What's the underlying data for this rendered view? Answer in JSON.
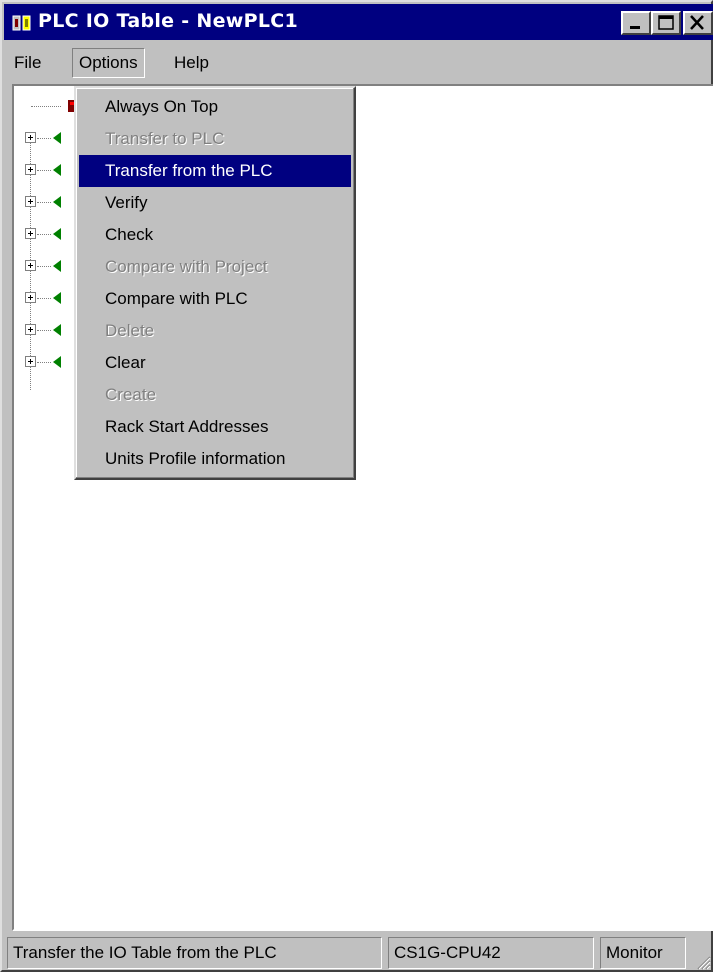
{
  "window": {
    "title": "PLC IO Table - NewPLC1",
    "icons": [
      "app-icon",
      "minimize-icon",
      "maximize-icon",
      "close-icon"
    ]
  },
  "menubar": {
    "file": "File",
    "options": "Options",
    "help": "Help"
  },
  "options_menu": {
    "items": [
      {
        "label": "Always On Top",
        "enabled": true
      },
      {
        "label": "Transfer to PLC",
        "enabled": false
      },
      {
        "label": "Transfer from the PLC",
        "enabled": true,
        "selected": true
      },
      {
        "label": "Verify",
        "enabled": true
      },
      {
        "label": "Check",
        "enabled": true
      },
      {
        "label": "Compare with Project",
        "enabled": false
      },
      {
        "label": "Compare with PLC",
        "enabled": true
      },
      {
        "label": "Delete",
        "enabled": false
      },
      {
        "label": "Clear",
        "enabled": true
      },
      {
        "label": "Create",
        "enabled": false
      },
      {
        "label": "Rack Start Addresses",
        "enabled": true
      },
      {
        "label": "Units Profile information",
        "enabled": true
      }
    ]
  },
  "tree": {
    "root_icon": "plc-root-icon",
    "node_icon": "rack-node-icon",
    "node_count": 8
  },
  "statusbar": {
    "message": "Transfer the IO Table from the PLC",
    "cpu": "CS1G-CPU42",
    "mode": "Monitor"
  },
  "colors": {
    "titlebar": "#000080",
    "highlight": "#000080",
    "face": "#c0c0c0",
    "node_green": "#008000",
    "root_red": "#800000"
  }
}
